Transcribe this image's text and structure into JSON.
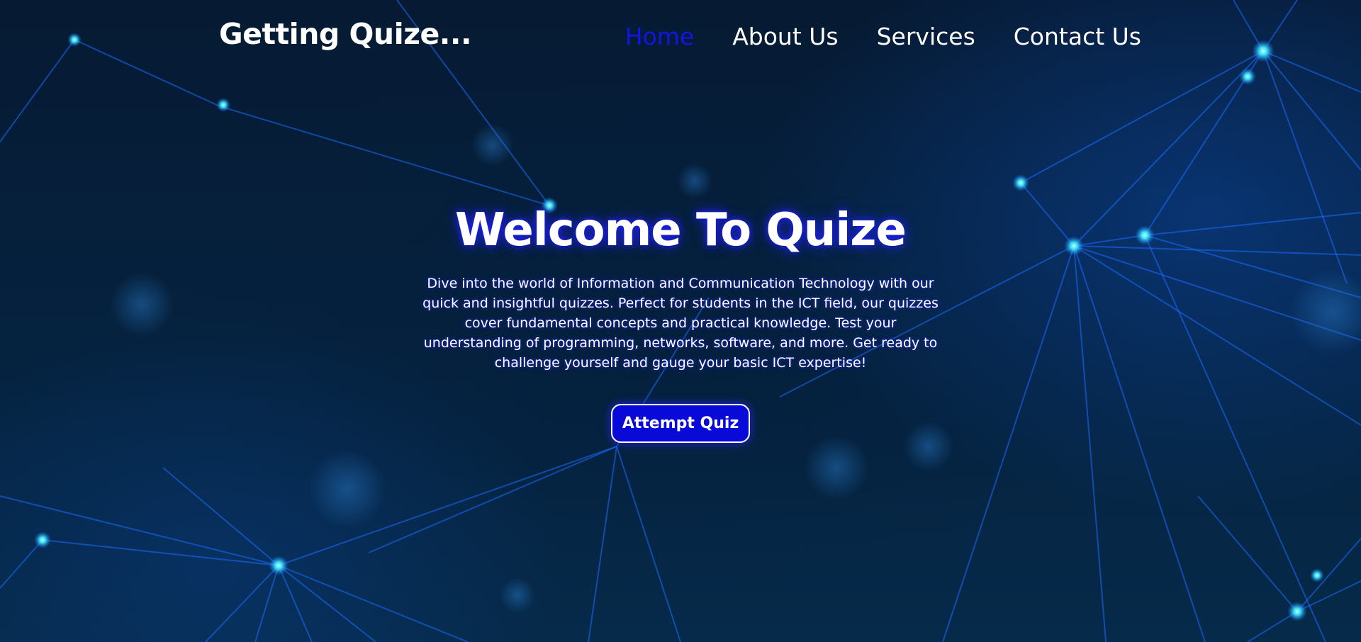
{
  "header": {
    "logo": "Getting Quize...",
    "nav": [
      {
        "label": "Home",
        "active": true
      },
      {
        "label": "About Us",
        "active": false
      },
      {
        "label": "Services",
        "active": false
      },
      {
        "label": "Contact Us",
        "active": false
      }
    ]
  },
  "hero": {
    "title": "Welcome To Quize",
    "description": "Dive into the world of Information and Communication Technology with our quick and insightful quizzes. Perfect for students in the ICT field, our quizzes cover fundamental concepts and practical knowledge. Test your understanding of programming, networks, software, and more. Get ready to challenge yourself and gauge your basic ICT expertise!",
    "cta_label": "Attempt Quiz"
  },
  "colors": {
    "accent": "#1414e6",
    "button": "#0a0ad8",
    "background": "#03132a",
    "network_line": "#1a6cff",
    "network_node": "#3ef0ff"
  },
  "background_graphic": "network-mesh-graphic"
}
